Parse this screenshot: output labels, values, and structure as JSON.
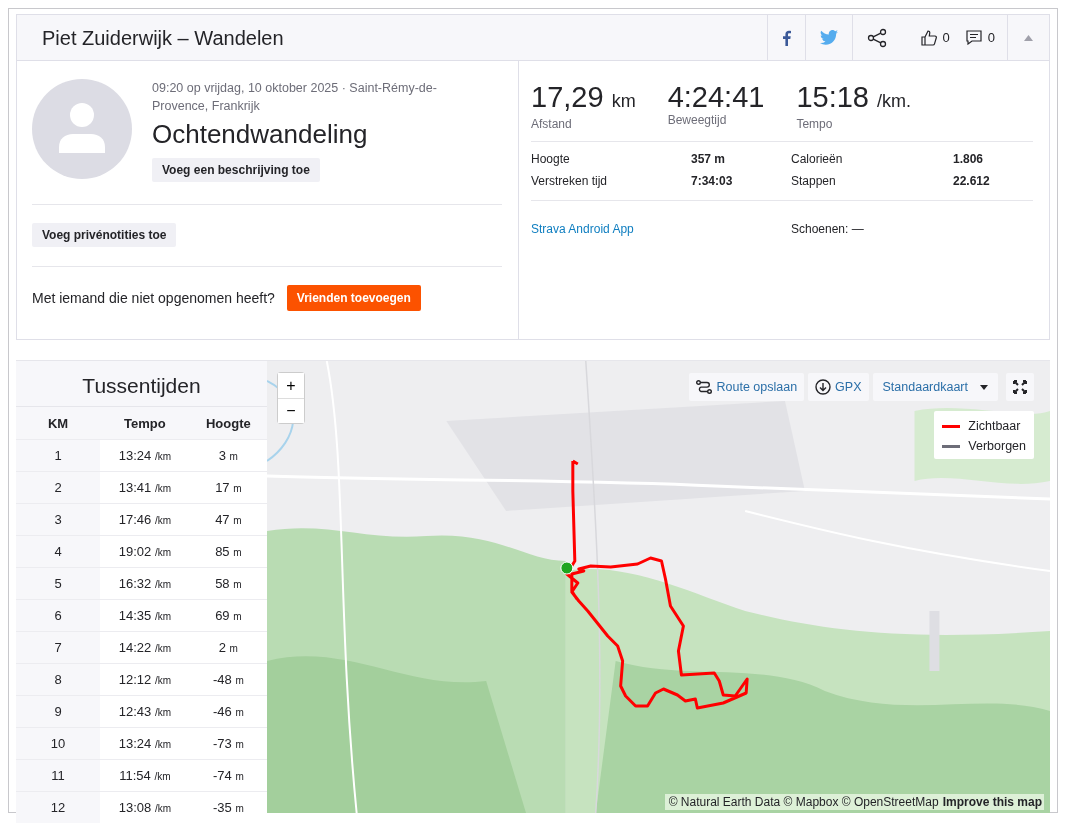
{
  "header": {
    "title": "Piet Zuiderwijk – Wandelen",
    "kudos_count": "0",
    "comment_count": "0"
  },
  "activity": {
    "meta": "09:20 op vrijdag, 10 oktober 2025 · Saint-Rémy-de-Provence, Frankrijk",
    "name": "Ochtendwandeling",
    "description_button": "Voeg een beschrijving toe",
    "notes_button": "Voeg privénotities toe",
    "friends_prompt": "Met iemand die niet opgenomen heeft?",
    "friends_button": "Vrienden toevoegen"
  },
  "stats": [
    {
      "value": "17,29",
      "unit": "km",
      "label": "Afstand"
    },
    {
      "value": "4:24:41",
      "label": "Beweegtijd"
    },
    {
      "value": "15:18",
      "unit": "/km.",
      "label": "Tempo"
    }
  ],
  "details": [
    {
      "label": "Hoogte",
      "value": "357 m"
    },
    {
      "label": "Calorieën",
      "value": "1.806"
    },
    {
      "label": "Verstreken tijd",
      "value": "7:34:03"
    },
    {
      "label": "Stappen",
      "value": "22.612"
    }
  ],
  "device": "Strava Android App",
  "shoes": "Schoenen: —",
  "splits": {
    "title": "Tussentijden",
    "columns": [
      "KM",
      "Tempo",
      "Hoogte"
    ],
    "rows": [
      {
        "km": "1",
        "pace": "13:24",
        "pace_unit": "/km",
        "elev": "3",
        "elev_unit": "m"
      },
      {
        "km": "2",
        "pace": "13:41",
        "pace_unit": "/km",
        "elev": "17",
        "elev_unit": "m"
      },
      {
        "km": "3",
        "pace": "17:46",
        "pace_unit": "/km",
        "elev": "47",
        "elev_unit": "m"
      },
      {
        "km": "4",
        "pace": "19:02",
        "pace_unit": "/km",
        "elev": "85",
        "elev_unit": "m"
      },
      {
        "km": "5",
        "pace": "16:32",
        "pace_unit": "/km",
        "elev": "58",
        "elev_unit": "m"
      },
      {
        "km": "6",
        "pace": "14:35",
        "pace_unit": "/km",
        "elev": "69",
        "elev_unit": "m"
      },
      {
        "km": "7",
        "pace": "14:22",
        "pace_unit": "/km",
        "elev": "2",
        "elev_unit": "m"
      },
      {
        "km": "8",
        "pace": "12:12",
        "pace_unit": "/km",
        "elev": "-48",
        "elev_unit": "m"
      },
      {
        "km": "9",
        "pace": "12:43",
        "pace_unit": "/km",
        "elev": "-46",
        "elev_unit": "m"
      },
      {
        "km": "10",
        "pace": "13:24",
        "pace_unit": "/km",
        "elev": "-73",
        "elev_unit": "m"
      },
      {
        "km": "11",
        "pace": "11:54",
        "pace_unit": "/km",
        "elev": "-74",
        "elev_unit": "m"
      },
      {
        "km": "12",
        "pace": "13:08",
        "pace_unit": "/km",
        "elev": "-35",
        "elev_unit": "m"
      }
    ]
  },
  "map": {
    "zoom_in": "+",
    "zoom_out": "−",
    "save_route": "Route opslaan",
    "gpx": "GPX",
    "style_select": "Standaardkaart",
    "legend": [
      {
        "label": "Zichtbaar",
        "color": "#ff0000"
      },
      {
        "label": "Verborgen",
        "color": "#6d6d78"
      }
    ],
    "attribution": "© Natural Earth Data © Mapbox © OpenStreetMap",
    "improve_link": "Improve this map"
  }
}
